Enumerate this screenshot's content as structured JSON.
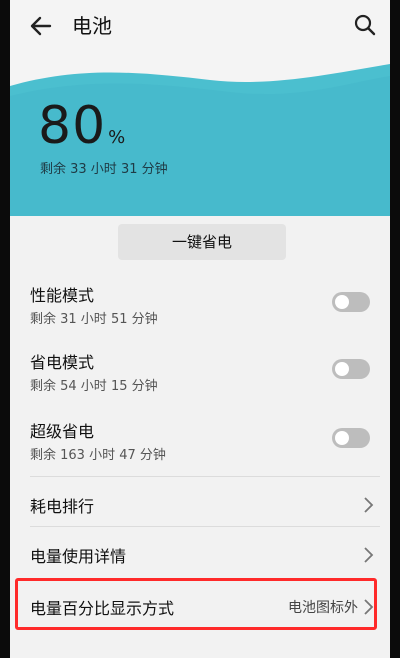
{
  "header": {
    "title": "电池",
    "back_icon": "back-arrow-icon",
    "search_icon": "search-icon"
  },
  "battery": {
    "percent": "80",
    "unit": "%",
    "remaining": "剩余 33 小时 31 分钟",
    "level": 0.8,
    "wave_color": "#4bbfcf"
  },
  "one_click": {
    "label": "一键省电"
  },
  "modes": [
    {
      "label": "性能模式",
      "sub": "剩余 31 小时 51 分钟",
      "enabled": false
    },
    {
      "label": "省电模式",
      "sub": "剩余 54 小时 15 分钟",
      "enabled": false
    },
    {
      "label": "超级省电",
      "sub": "剩余 163 小时 47 分钟",
      "enabled": false
    }
  ],
  "links": [
    {
      "label": "耗电排行",
      "value": ""
    },
    {
      "label": "电量使用详情",
      "value": ""
    },
    {
      "label": "电量百分比显示方式",
      "value": "电池图标外",
      "highlighted": true
    }
  ],
  "colors": {
    "highlight": "#ff2a2a",
    "toggle_off": "#bdbdbd"
  }
}
